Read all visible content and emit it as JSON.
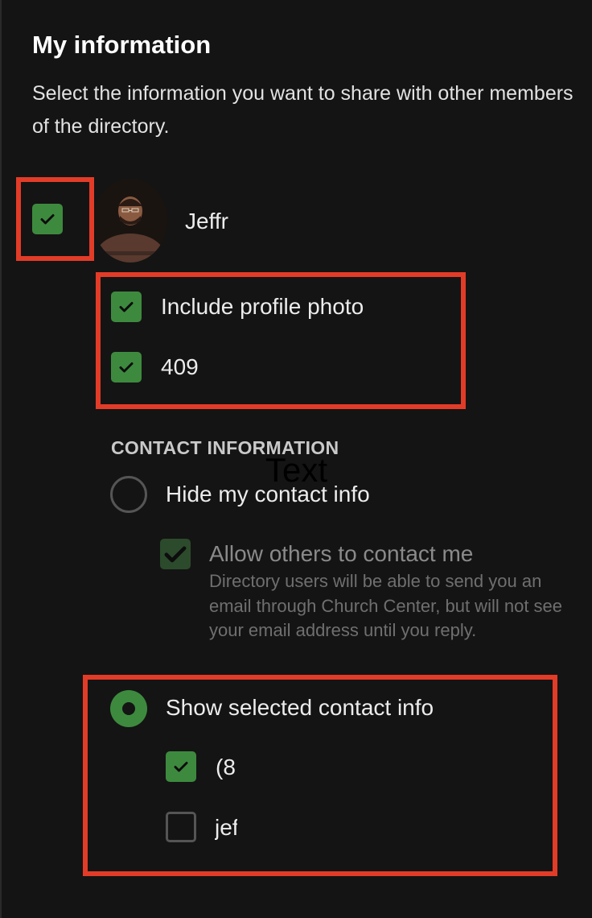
{
  "header": {
    "title": "My information",
    "description": "Select the information you want to share with other members of the directory."
  },
  "profile": {
    "checked": true,
    "name": "Jeffr",
    "avatar": "profile-photo"
  },
  "options": {
    "include_photo_label": "Include profile photo",
    "include_photo_checked": true,
    "second_label": "409",
    "second_checked": true
  },
  "contact": {
    "section_title": "CONTACT INFORMATION",
    "overlay_text": "Text",
    "hide_label": "Hide my contact info",
    "hide_selected": false,
    "allow_label": "Allow others to contact me",
    "allow_checked": true,
    "allow_help": "Directory users will be able to send you an email through Church Center, but will not see your email address until you reply.",
    "show_label": "Show selected contact info",
    "show_selected": true,
    "items": [
      {
        "label": "(8",
        "checked": true
      },
      {
        "label": "jef",
        "checked": false
      }
    ]
  },
  "colors": {
    "background": "#141414",
    "accent_green": "#3d8a3e",
    "annotation_red": "#e23c28"
  }
}
